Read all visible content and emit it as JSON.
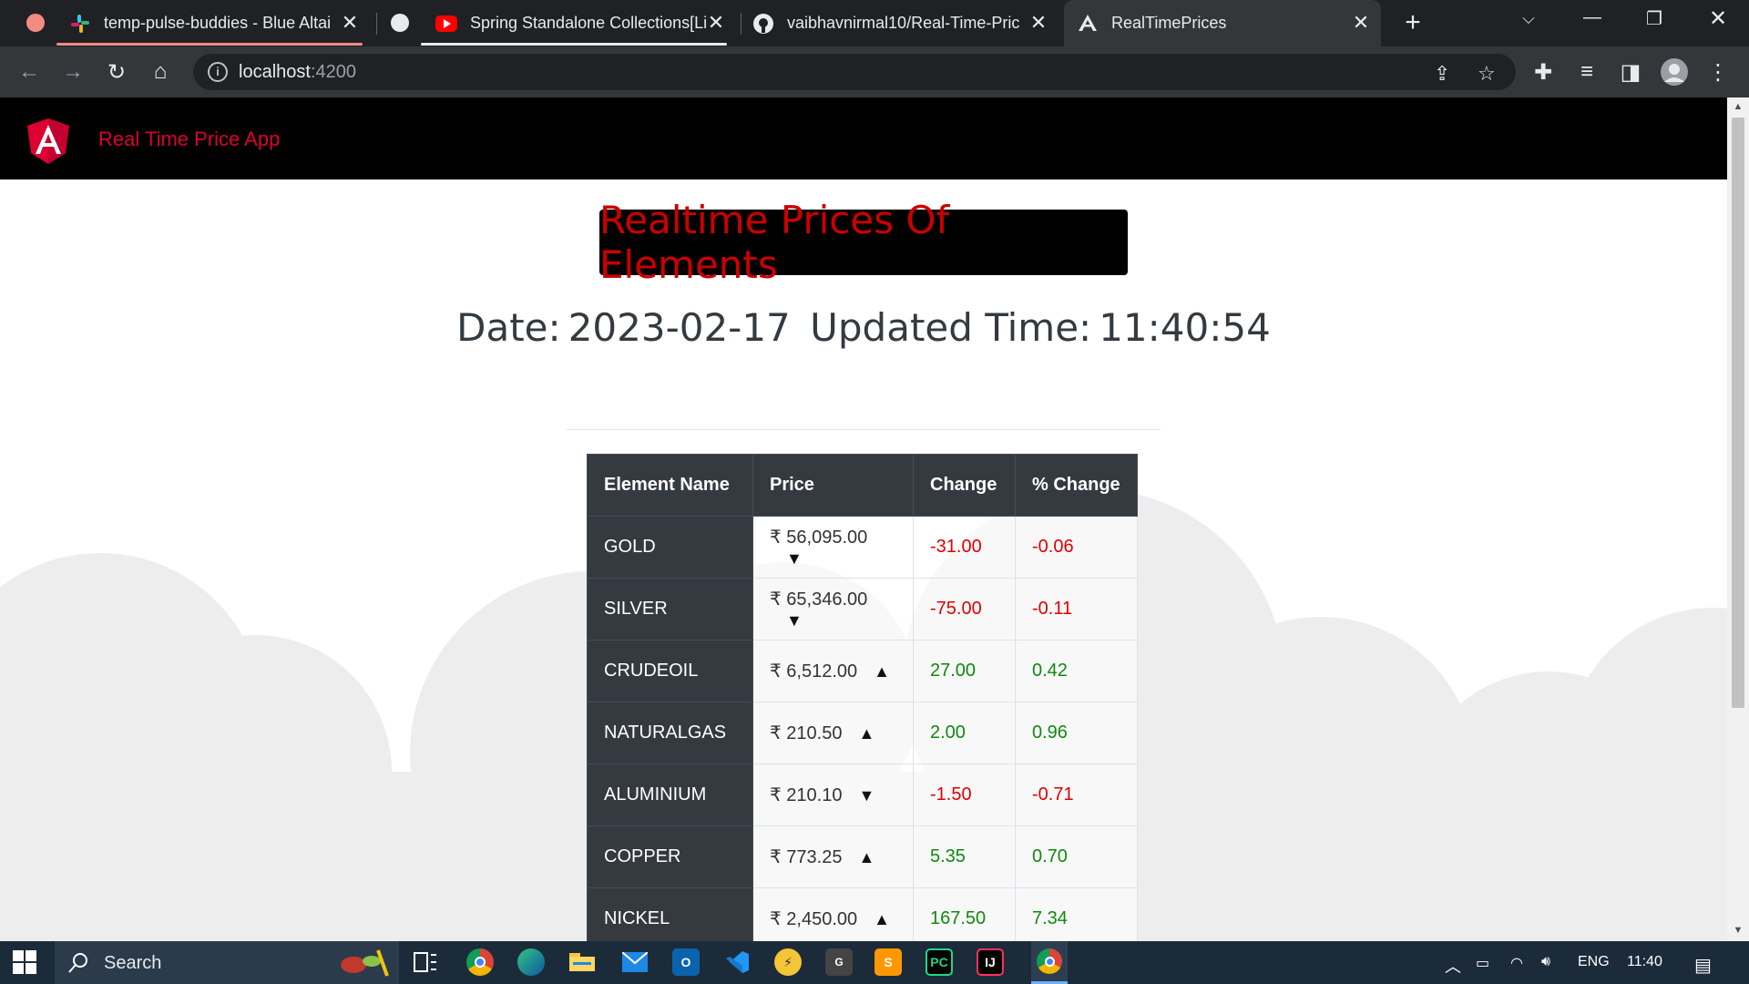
{
  "browser": {
    "tabs": [
      {
        "label": "temp-pulse-buddies - Blue Altai",
        "favicon": "slack-icon"
      },
      {
        "label": "Spring Standalone Collections[Li",
        "favicon": "youtube-icon"
      },
      {
        "label": "vaibhavnirmal10/Real-Time-Pric",
        "favicon": "github-icon"
      },
      {
        "label": "RealTimePrices",
        "favicon": "angular-icon"
      }
    ],
    "url": {
      "host": "localhost",
      "port": ":4200"
    }
  },
  "app": {
    "brand": "Real Time Price App",
    "heading": "Realtime Prices Of Elements",
    "date_label": "Date:",
    "date_value": "2023-02-17",
    "time_label": "Updated Time:",
    "time_value": "11:40:54"
  },
  "table": {
    "headers": [
      "Element Name",
      "Price",
      "Change",
      "% Change"
    ],
    "rows": [
      {
        "name": "GOLD",
        "price": "₹ 56,095.00",
        "direction": "down",
        "change": "-31.00",
        "pct": "-0.06"
      },
      {
        "name": "SILVER",
        "price": "₹ 65,346.00",
        "direction": "down",
        "change": "-75.00",
        "pct": "-0.11"
      },
      {
        "name": "CRUDEOIL",
        "price": "₹ 6,512.00",
        "direction": "up",
        "change": "27.00",
        "pct": "0.42"
      },
      {
        "name": "NATURALGAS",
        "price": "₹ 210.50",
        "direction": "up",
        "change": "2.00",
        "pct": "0.96"
      },
      {
        "name": "ALUMINIUM",
        "price": "₹ 210.10",
        "direction": "down",
        "change": "-1.50",
        "pct": "-0.71"
      },
      {
        "name": "COPPER",
        "price": "₹ 773.25",
        "direction": "up",
        "change": "5.35",
        "pct": "0.70"
      },
      {
        "name": "NICKEL",
        "price": "₹ 2,450.00",
        "direction": "up",
        "change": "167.50",
        "pct": "7.34"
      }
    ]
  },
  "taskbar": {
    "search_label": "Search",
    "language": "ENG",
    "clock": "11:40"
  },
  "colors": {
    "brand_red": "#dd0031",
    "heading_red": "#cc0000",
    "down_red": "#e00000",
    "up_green": "#108810",
    "table_dark": "#343a40"
  }
}
